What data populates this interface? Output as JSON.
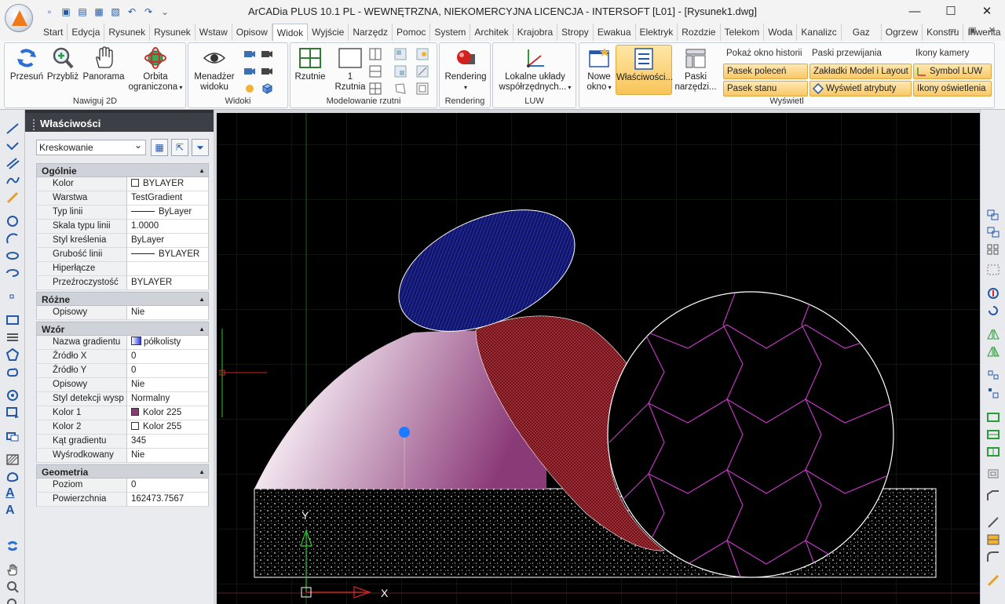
{
  "window": {
    "title": "ArCADia PLUS 10.1 PL - WEWNĘTRZNA, NIEKOMERCYJNA LICENCJA - INTERSOFT [L01] - [Rysunek1.dwg]",
    "minimize": "—",
    "maximize": "☐",
    "close": "✕"
  },
  "quick_access": {
    "icons": [
      "new-icon",
      "open-icon",
      "open-folder-icon",
      "save-icon",
      "save-as-icon",
      "undo-icon",
      "redo-icon",
      "dropdown-icon"
    ]
  },
  "tabs": [
    "Start",
    "Edycja",
    "Rysunek",
    "Rysunek",
    "Wstaw",
    "Opisow",
    "Widok",
    "Wyjście",
    "Narzędz",
    "Pomoc",
    "System",
    "Architek",
    "Krajobra",
    "Stropy",
    "Ewakua",
    "Elektryk",
    "Rozdzie",
    "Telekom",
    "Woda",
    "Kanalizc",
    "Gaz",
    "Ogrzew",
    "Konstru",
    "Inwenta"
  ],
  "active_tab": "Widok",
  "ribbon": {
    "nawiguj": {
      "title": "Nawiguj 2D",
      "przesun": "Przesuń",
      "przybliz": "Przybliż",
      "panorama": "Panorama",
      "orbita_1": "Orbita",
      "orbita_2": "ograniczona"
    },
    "widoki": {
      "title": "Widoki",
      "menedzer_1": "Menadżer",
      "menedzer_2": "widoku"
    },
    "modelowanie": {
      "title": "Modelowanie rzutni",
      "rzutnie": "Rzutnie",
      "jedna_1": "1",
      "jedna_2": "Rzutnia"
    },
    "rendering": {
      "title": "Rendering",
      "label": "Rendering"
    },
    "luw": {
      "title": "LUW",
      "label_1": "Lokalne układy",
      "label_2": "współrzędnych..."
    },
    "wyswietl": {
      "title": "Wyświetl",
      "nowe_okno_1": "Nowe",
      "nowe_okno_2": "okno",
      "wlasciwosci": "Właściwości...",
      "paski_1": "Paski",
      "paski_2": "narzędzi...",
      "pokaz_historii": "Pokaż okno historii",
      "paski_przewijania": "Paski przewijania",
      "ikony_kamery": "Ikony kamery",
      "pasek_polecen": "Pasek poleceń",
      "zakladki": "Zakładki Model i Layout",
      "symbol_luw": "Symbol LUW",
      "pasek_stanu": "Pasek stanu",
      "wyswietl_atrybuty": "Wyświetl atrybuty",
      "ikony_oswietlenia": "Ikony oświetlenia"
    }
  },
  "properties": {
    "header": "Właściwości",
    "selected_type": "Kreskowanie",
    "sections": {
      "ogolne": "Ogólnie",
      "rozne": "Różne",
      "wzor": "Wzór",
      "geometria": "Geometria"
    },
    "ogolne": [
      {
        "k": "Kolor",
        "v": "BYLAYER"
      },
      {
        "k": "Warstwa",
        "v": "TestGradient"
      },
      {
        "k": "Typ linii",
        "v": "ByLayer"
      },
      {
        "k": "Skala typu linii",
        "v": "1.0000"
      },
      {
        "k": "Styl kreślenia",
        "v": "ByLayer"
      },
      {
        "k": "Grubość linii",
        "v": "BYLAYER"
      },
      {
        "k": "Hiperłącze",
        "v": ""
      },
      {
        "k": "Przeźroczystość",
        "v": "BYLAYER"
      }
    ],
    "rozne": [
      {
        "k": "Opisowy",
        "v": "Nie"
      }
    ],
    "wzor": [
      {
        "k": "Nazwa gradientu",
        "v": "półkolisty"
      },
      {
        "k": "Źródło X",
        "v": "0"
      },
      {
        "k": "Źródło Y",
        "v": "0"
      },
      {
        "k": "Opisowy",
        "v": "Nie"
      },
      {
        "k": "Styl detekcji wysp",
        "v": "Normalny"
      },
      {
        "k": "Kolor 1",
        "v": "Kolor 225"
      },
      {
        "k": "Kolor 2",
        "v": "Kolor 255"
      },
      {
        "k": "Kąt gradientu",
        "v": "345"
      },
      {
        "k": "Wyśrodkowany",
        "v": "Nie"
      }
    ],
    "geometria": [
      {
        "k": "Poziom",
        "v": "0"
      },
      {
        "k": "Powierzchnia",
        "v": "162473.7567"
      }
    ],
    "colors": {
      "kolor1": "#8b3a78",
      "kolor2": "#ffffff"
    }
  },
  "canvas": {
    "background": "#000000",
    "axis_y": "Y",
    "axis_x": "X",
    "colors": {
      "ellipse_hatch": "#1a1f7a",
      "red_hatch": "#7a1a22",
      "gradient_1": "#8b3a78",
      "pattern_lines": "#d03ad0",
      "grip": "#1e7bff"
    }
  }
}
